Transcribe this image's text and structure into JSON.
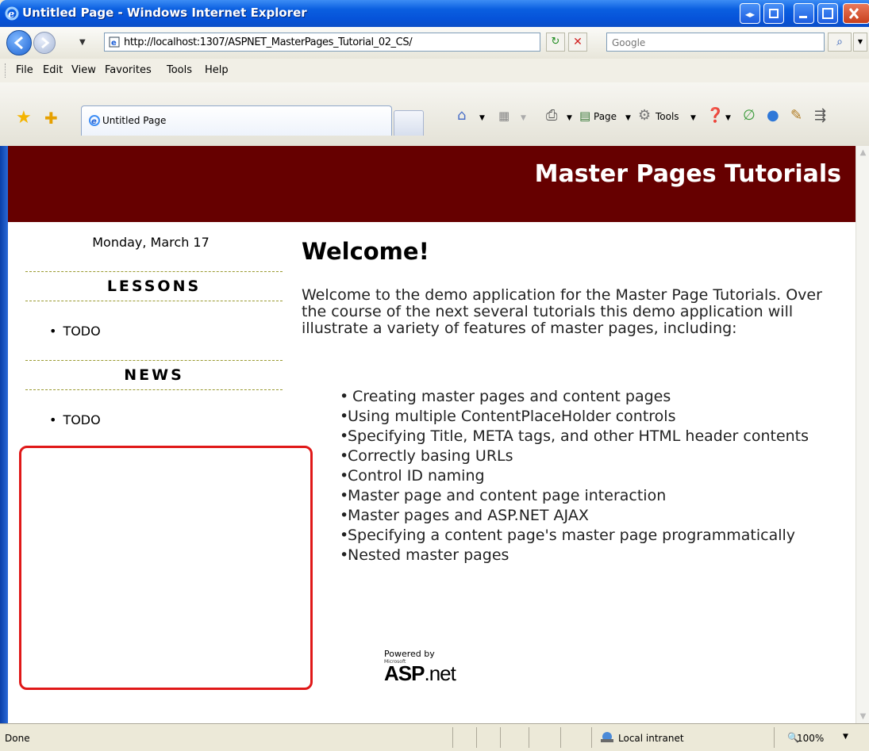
{
  "window": {
    "title": "Untitled Page - Windows Internet Explorer"
  },
  "address": {
    "url": "http://localhost:1307/ASPNET_MasterPages_Tutorial_02_CS/",
    "search_placeholder": "Google"
  },
  "menu": {
    "items": [
      "File",
      "Edit",
      "View",
      "Favorites",
      "Tools",
      "Help"
    ]
  },
  "tabs": {
    "active_tab": "Untitled Page"
  },
  "commands": {
    "page": "Page",
    "tools": "Tools"
  },
  "page": {
    "banner_title": "Master Pages Tutorials",
    "date": "Monday, March 17",
    "lessons_heading": "LESSONS",
    "lessons_item": "TODO",
    "news_heading": "NEWS",
    "news_item": "TODO",
    "heading": "Welcome!",
    "intro": "Welcome to the demo application for the Master Page Tutorials. Over the course of the next several tutorials this demo application will illustrate a variety of features of master pages, including:",
    "features": [
      " Creating master pages and content pages",
      "Using multiple ContentPlaceHolder controls",
      "Specifying Title, META tags, and other HTML header contents",
      "Correctly basing URLs",
      "Control ID naming",
      "Master page and content page interaction",
      "Master pages and ASP.NET AJAX",
      "Specifying a content page's master page programmatically",
      "Nested master pages"
    ],
    "powered_by": "Powered by",
    "powered_ms": "Microsoft",
    "powered_asp": "ASP",
    "powered_net": ".net"
  },
  "status": {
    "text": "Done",
    "zone": "Local intranet",
    "zoom": "100%"
  },
  "colors": {
    "banner": "#660000",
    "highlight_box": "#e01818",
    "titlebar": "#0653d9"
  }
}
